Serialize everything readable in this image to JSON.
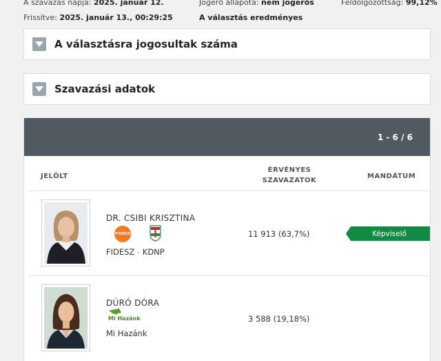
{
  "meta": {
    "election_day_label": "A szavazás napja:",
    "election_day_value": "2025. január 12.",
    "updated_label": "Frissítve:",
    "updated_value": "2025. január 13., 00:29:25",
    "legal_status_label": "Jogerő állapota:",
    "legal_status_value": "nem jogerős",
    "result_status": "A választás eredményes",
    "processed_label": "Feldolgozottság:",
    "processed_value": "99,12%"
  },
  "panels": {
    "eligible_title": "A választásra jogosultak száma",
    "voting_data_title": "Szavazási adatok"
  },
  "results": {
    "pager": "1 - 6 / 6",
    "columns": {
      "candidate": "JELÖLT",
      "valid_votes_line1": "ÉRVÉNYES",
      "valid_votes_line2": "SZAVAZATOK",
      "mandate": "MANDÁTUM"
    },
    "candidates": [
      {
        "name": "DR. CSIBI KRISZTINA",
        "party_part1": "FIDESZ",
        "party_sep": " - ",
        "party_part2": "KDNP",
        "party_logos": [
          "fidesz-logo",
          "kdnp-logo"
        ],
        "logo_text": "FIDESZ",
        "votes": "11 913 (63,7%)",
        "mandate": "Képviselő"
      },
      {
        "name": "DÚRÓ DÓRA",
        "party": "Mi Hazánk",
        "party_logos": [
          "mi-hazank-logo"
        ],
        "logo_text": "Mi Hazánk",
        "votes": "3 588 (19,18%)",
        "mandate": ""
      }
    ]
  },
  "colors": {
    "header_bar": "#525a61",
    "mandate_badge": "#138a44",
    "toggle": "#9ba5ad",
    "fidesz_orange": "#f47a20",
    "mi_hazank_green": "#5a9a2a"
  }
}
